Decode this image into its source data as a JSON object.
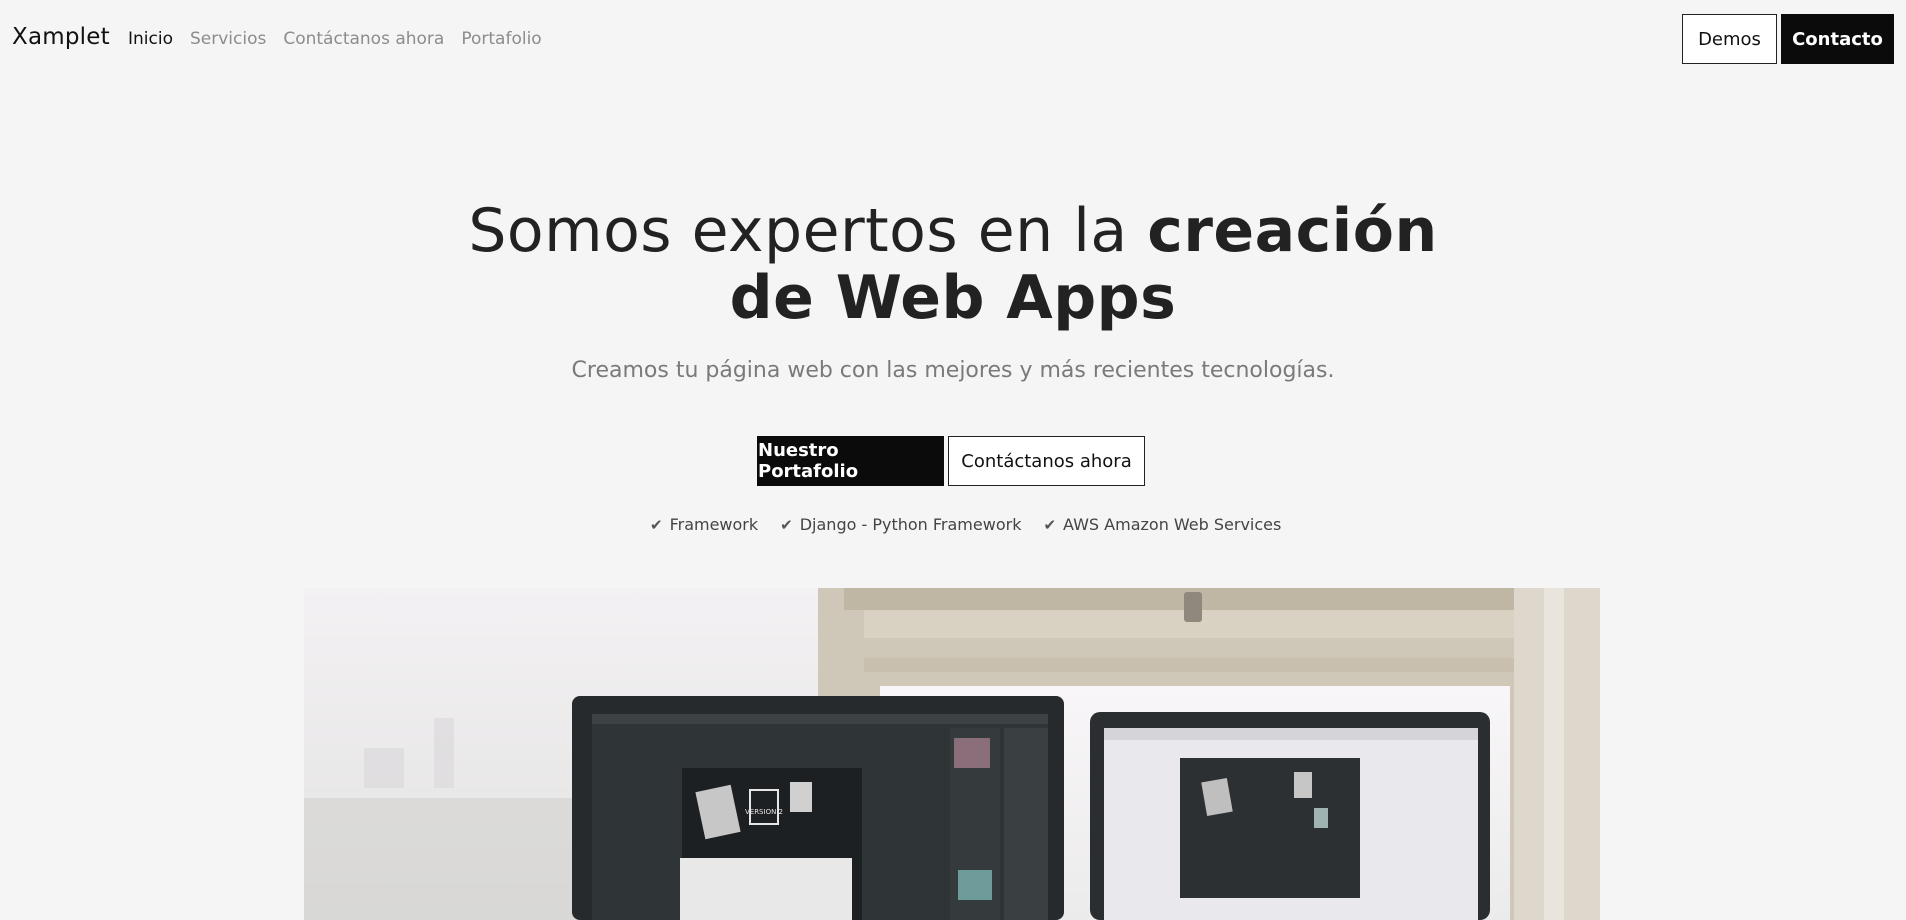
{
  "nav": {
    "brand": "Xamplet",
    "links": [
      "Inicio",
      "Servicios",
      "Contáctanos ahora",
      "Portafolio"
    ],
    "demos_label": "Demos",
    "contact_label": "Contacto"
  },
  "hero": {
    "title_regular": "Somos expertos en la",
    "title_bold_1": "creación",
    "title_bold_2": "de Web Apps",
    "subtitle": "Creamos tu página web con las mejores y más recientes tecnologías.",
    "primary_button": "Nuestro Portafolio",
    "secondary_button": "Contáctanos ahora",
    "features": [
      "Framework",
      "Django - Python Framework",
      "AWS Amazon Web Services"
    ]
  },
  "image": {
    "screen_logo_text": "VERSION 2"
  },
  "colors": {
    "background": "#f5f5f5",
    "dark": "#0b0b0b"
  }
}
